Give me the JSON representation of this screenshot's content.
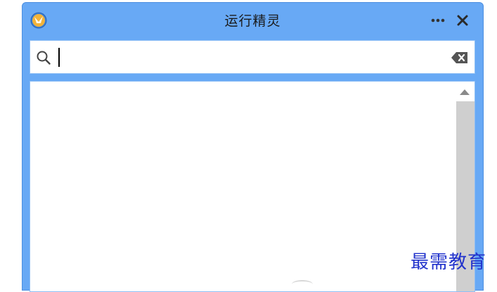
{
  "window": {
    "title": "运行精灵"
  },
  "titlebar": {
    "app_icon": "app-logo-icon",
    "more_icon": "more-dots-icon",
    "close_icon": "close-icon"
  },
  "search": {
    "value": "",
    "placeholder": "",
    "search_icon": "search-icon",
    "clear_icon": "backspace-clear-icon"
  },
  "results": {
    "items": []
  },
  "scrollbar": {
    "up_icon": "scroll-up-arrow-icon"
  },
  "watermark": {
    "text": "最需教育"
  },
  "colors": {
    "titlebar_bg": "#68a9f5",
    "scroll_track": "#cfcfcf",
    "watermark": "#2233cc"
  }
}
